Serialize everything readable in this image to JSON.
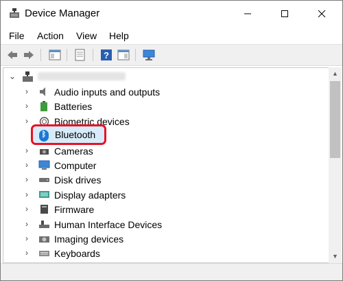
{
  "window": {
    "title": "Device Manager",
    "controls": {
      "minimize": "—",
      "maximize": "☐",
      "close": "✕"
    }
  },
  "menu": [
    "File",
    "Action",
    "View",
    "Help"
  ],
  "toolbar": [
    "back-icon",
    "forward-icon",
    "properties-icon",
    "update-driver-icon",
    "help-icon",
    "console-tree-icon",
    "scan-hardware-icon"
  ],
  "tree": {
    "root_expanded": true,
    "items": [
      {
        "label": "Audio inputs and outputs",
        "icon": "speaker-icon"
      },
      {
        "label": "Batteries",
        "icon": "battery-icon"
      },
      {
        "label": "Biometric devices",
        "icon": "biometric-icon"
      },
      {
        "label": "Bluetooth",
        "icon": "bluetooth-icon",
        "highlighted": true
      },
      {
        "label": "Cameras",
        "icon": "camera-icon"
      },
      {
        "label": "Computer",
        "icon": "computer-icon"
      },
      {
        "label": "Disk drives",
        "icon": "disk-icon"
      },
      {
        "label": "Display adapters",
        "icon": "display-adapter-icon"
      },
      {
        "label": "Firmware",
        "icon": "firmware-icon"
      },
      {
        "label": "Human Interface Devices",
        "icon": "hid-icon"
      },
      {
        "label": "Imaging devices",
        "icon": "imaging-icon"
      },
      {
        "label": "Keyboards",
        "icon": "keyboard-icon"
      }
    ]
  },
  "colors": {
    "highlight_border": "#e81123",
    "selection_fill": "#d7ebfa",
    "bluetooth_blue": "#1a78d6"
  }
}
